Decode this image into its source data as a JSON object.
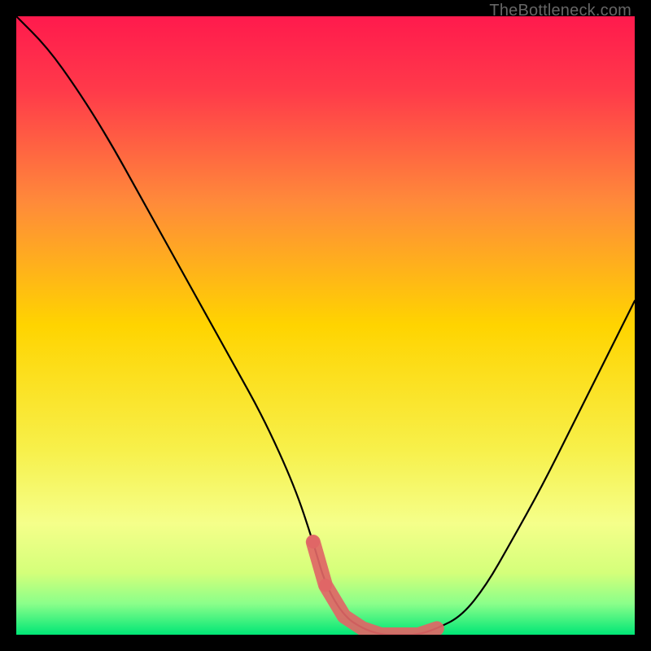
{
  "attribution": "TheBottleneck.com",
  "colors": {
    "bg": "#000000",
    "gradient_top": "#ff1a4d",
    "gradient_mid": "#ffd400",
    "gradient_low": "#f5ff8a",
    "gradient_bottom": "#00e676",
    "curve": "#000000",
    "marker_fill": "#e06666",
    "marker_stroke": "#cc5555"
  },
  "chart_data": {
    "type": "line",
    "title": "",
    "xlabel": "",
    "ylabel": "",
    "xlim": [
      0,
      100
    ],
    "ylim": [
      0,
      100
    ],
    "series": [
      {
        "name": "bottleneck-curve",
        "x": [
          0,
          5,
          10,
          15,
          20,
          25,
          30,
          35,
          40,
          45,
          48,
          50,
          53,
          56,
          59,
          62,
          65,
          68,
          72,
          76,
          80,
          85,
          90,
          95,
          100
        ],
        "y": [
          100,
          95,
          88,
          80,
          71,
          62,
          53,
          44,
          35,
          24,
          15,
          8,
          3,
          1,
          0,
          0,
          0,
          1,
          3,
          8,
          15,
          24,
          34,
          44,
          54
        ]
      }
    ],
    "markers": {
      "name": "highlight-band",
      "x": [
        48,
        50,
        53,
        56,
        59,
        62,
        65,
        68
      ],
      "y": [
        15,
        8,
        3,
        1,
        0,
        0,
        0,
        1
      ]
    }
  }
}
